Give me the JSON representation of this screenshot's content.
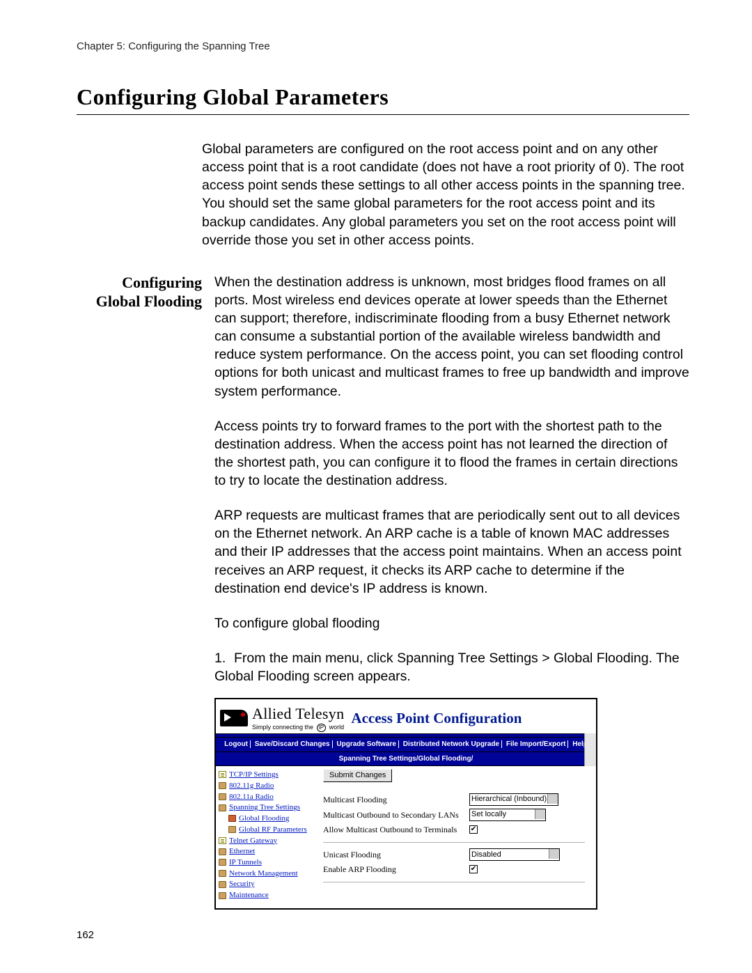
{
  "doc": {
    "chapter_line": "Chapter 5: Configuring the Spanning Tree",
    "section_title": "Configuring Global Parameters",
    "page_number": "162",
    "intro_paragraph": "Global parameters are configured on the root access point and on any other access point that is a root candidate (does not have a root priority of 0). The root access point sends these settings to all other access points in the spanning tree. You should set the same global parameters for the root access point and its backup candidates. Any global parameters you set on the root access point will override those you set in other access points.",
    "side_heading_line1": "Configuring",
    "side_heading_line2": "Global Flooding",
    "para1": "When the destination address is unknown, most bridges flood frames on all ports. Most wireless end devices operate at lower speeds than the Ethernet can support; therefore, indiscriminate flooding from a busy Ethernet network can consume a substantial portion of the available wireless bandwidth and reduce system performance. On the access point, you can set flooding control options for both unicast and multicast frames to free up bandwidth and improve system performance.",
    "para2": "Access points try to forward frames to the port with the shortest path to the destination address. When the access point has not learned the direction of the shortest path, you can configure it to flood the frames in certain directions to try to locate the destination address.",
    "para3": "ARP requests are multicast frames that are periodically sent out to all devices on the Ethernet network. An ARP cache is a table of known MAC addresses and their IP addresses that the access point maintains. When an access point receives an ARP request, it checks its ARP cache to determine if the destination end device's IP address is known.",
    "para4": "To configure global flooding",
    "step1_num": "1.",
    "step1_text": "From the main menu, click Spanning Tree Settings > Global Flooding. The Global Flooding screen appears."
  },
  "ui": {
    "brand_name": "Allied Telesyn",
    "brand_tag_pre": "Simply connecting the",
    "brand_tag_ip": "IP",
    "brand_tag_post": "world",
    "header_title": "Access Point Configuration",
    "menu": {
      "logout": "Logout",
      "save": "Save/Discard Changes",
      "upgrade": "Upgrade Software",
      "dist": "Distributed Network Upgrade",
      "io": "File Import/Export",
      "help": "Help"
    },
    "breadcrumb": "Spanning Tree Settings/Global Flooding/",
    "tree": {
      "tcpip": "TCP/IP Settings",
      "r80211g": "802.11g Radio",
      "r80211a": "802.11a Radio",
      "spanning": "Spanning Tree Settings",
      "global_flooding": "Global Flooding",
      "global_rf": "Global RF Parameters",
      "telnet": "Telnet Gateway",
      "ethernet": "Ethernet",
      "iptunnels": "IP Tunnels",
      "netmgmt": "Network Management",
      "security": "Security",
      "maintenance": "Maintenance"
    },
    "form": {
      "submit_btn": "Submit Changes",
      "multicast_flooding_label": "Multicast Flooding",
      "multicast_flooding_value": "Hierarchical (Inbound)",
      "multicast_outbound_lans_label": "Multicast Outbound to Secondary LANs",
      "multicast_outbound_lans_value": "Set locally",
      "allow_multicast_terminals_label": "Allow Multicast Outbound to Terminals",
      "allow_multicast_terminals_checked": "✔",
      "unicast_flooding_label": "Unicast Flooding",
      "unicast_flooding_value": "Disabled",
      "enable_arp_label": "Enable ARP Flooding",
      "enable_arp_checked": "✔"
    },
    "scroll_up": "▲",
    "scroll_down": "▼"
  }
}
